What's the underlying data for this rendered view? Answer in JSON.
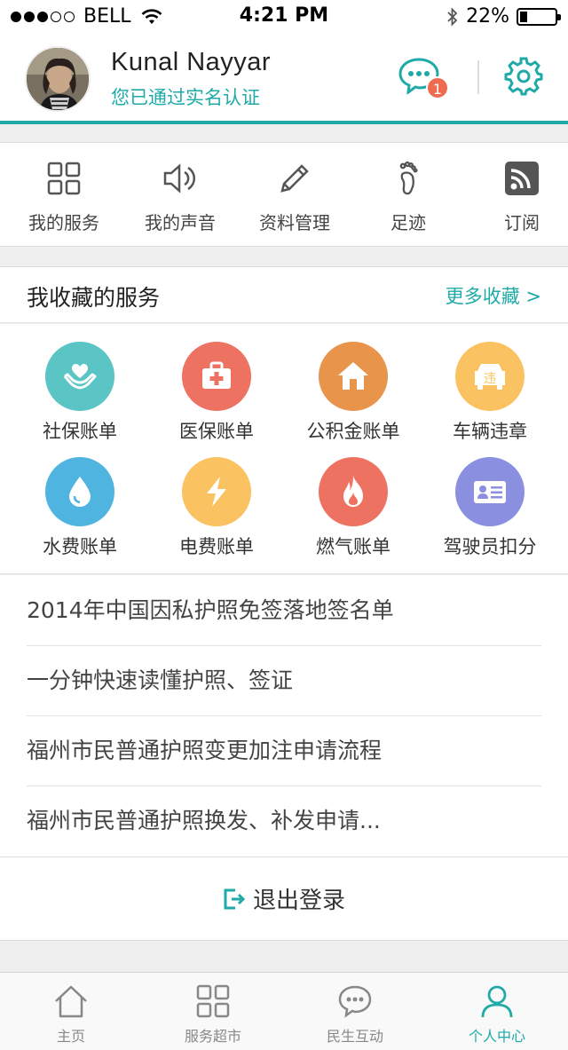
{
  "status_bar": {
    "carrier": "BELL",
    "time": "4:21 PM",
    "battery": "22%",
    "battery_level": 0.22
  },
  "header": {
    "name": "Kunal Nayyar",
    "subtitle": "您已通过实名认证",
    "message_badge": "1",
    "accent": "#1faaa8"
  },
  "quick_actions": [
    {
      "label": "我的服务",
      "icon": "grid-icon"
    },
    {
      "label": "我的声音",
      "icon": "speaker-icon"
    },
    {
      "label": "资料管理",
      "icon": "pencil-icon"
    },
    {
      "label": "足迹",
      "icon": "footprint-icon"
    },
    {
      "label": "订阅",
      "icon": "rss-icon"
    }
  ],
  "favorites": {
    "title": "我收藏的服务",
    "more": "更多收藏 >",
    "items": [
      {
        "label": "社保账单",
        "icon": "heart-hands-icon",
        "color": "#5bc4c4"
      },
      {
        "label": "医保账单",
        "icon": "medical-kit-icon",
        "color": "#ee7262"
      },
      {
        "label": "公积金账单",
        "icon": "house-icon",
        "color": "#e8944a"
      },
      {
        "label": "车辆违章",
        "icon": "car-icon",
        "color": "#fbc261"
      },
      {
        "label": "水费账单",
        "icon": "water-drop-icon",
        "color": "#4fb4e0"
      },
      {
        "label": "电费账单",
        "icon": "lightning-icon",
        "color": "#fbc261"
      },
      {
        "label": "燃气账单",
        "icon": "flame-icon",
        "color": "#ee7262"
      },
      {
        "label": "驾驶员扣分",
        "icon": "id-card-icon",
        "color": "#8a8fe0"
      }
    ],
    "car_glyph": "违"
  },
  "news": [
    "2014年中国因私护照免签落地签名单",
    "一分钟快速读懂护照、签证",
    "福州市民普通护照变更加注申请流程",
    "福州市民普通护照换发、补发申请..."
  ],
  "logout_label": "退出登录",
  "tabs": [
    {
      "label": "主页",
      "icon": "home-icon"
    },
    {
      "label": "服务超市",
      "icon": "grid-icon"
    },
    {
      "label": "民生互动",
      "icon": "chat-icon"
    },
    {
      "label": "个人中心",
      "icon": "person-icon"
    }
  ],
  "active_tab": 3
}
